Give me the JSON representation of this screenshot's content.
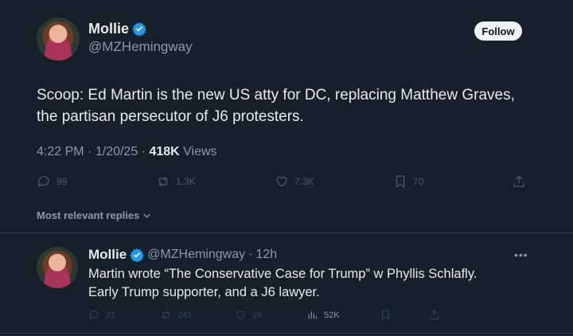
{
  "tweet": {
    "display_name": "Mollie",
    "handle": "@MZHemingway",
    "follow_label": "Follow",
    "text_line1": "Scoop: Ed Martin is the new US atty for DC, replacing Matthew Graves,",
    "text_line2": "the partisan persecutor of J6 protesters.",
    "time": "4:22 PM",
    "date": "1/20/25",
    "views_count": "418K",
    "views_label": "Views",
    "replies": "99",
    "reposts": "1.3K",
    "likes": "7.3K",
    "bookmarks": "70"
  },
  "replies_filter": {
    "label": "Most relevant replies"
  },
  "reply": {
    "display_name": "Mollie",
    "handle": "@MZHemingway",
    "age": "12h",
    "text_line1": "Martin wrote “The Conservative Case for Trump” w Phyllis Schlafly.",
    "text_line2": "Early Trump supporter, and a J6 lawyer.",
    "replies": "21",
    "reposts": "241",
    "likes": "2K",
    "views": "52K"
  },
  "colors": {
    "background": "#15202b",
    "verified_blue": "#1d9bf0",
    "muted_text": "#8b98a5",
    "dim_icon": "#4b5966"
  }
}
